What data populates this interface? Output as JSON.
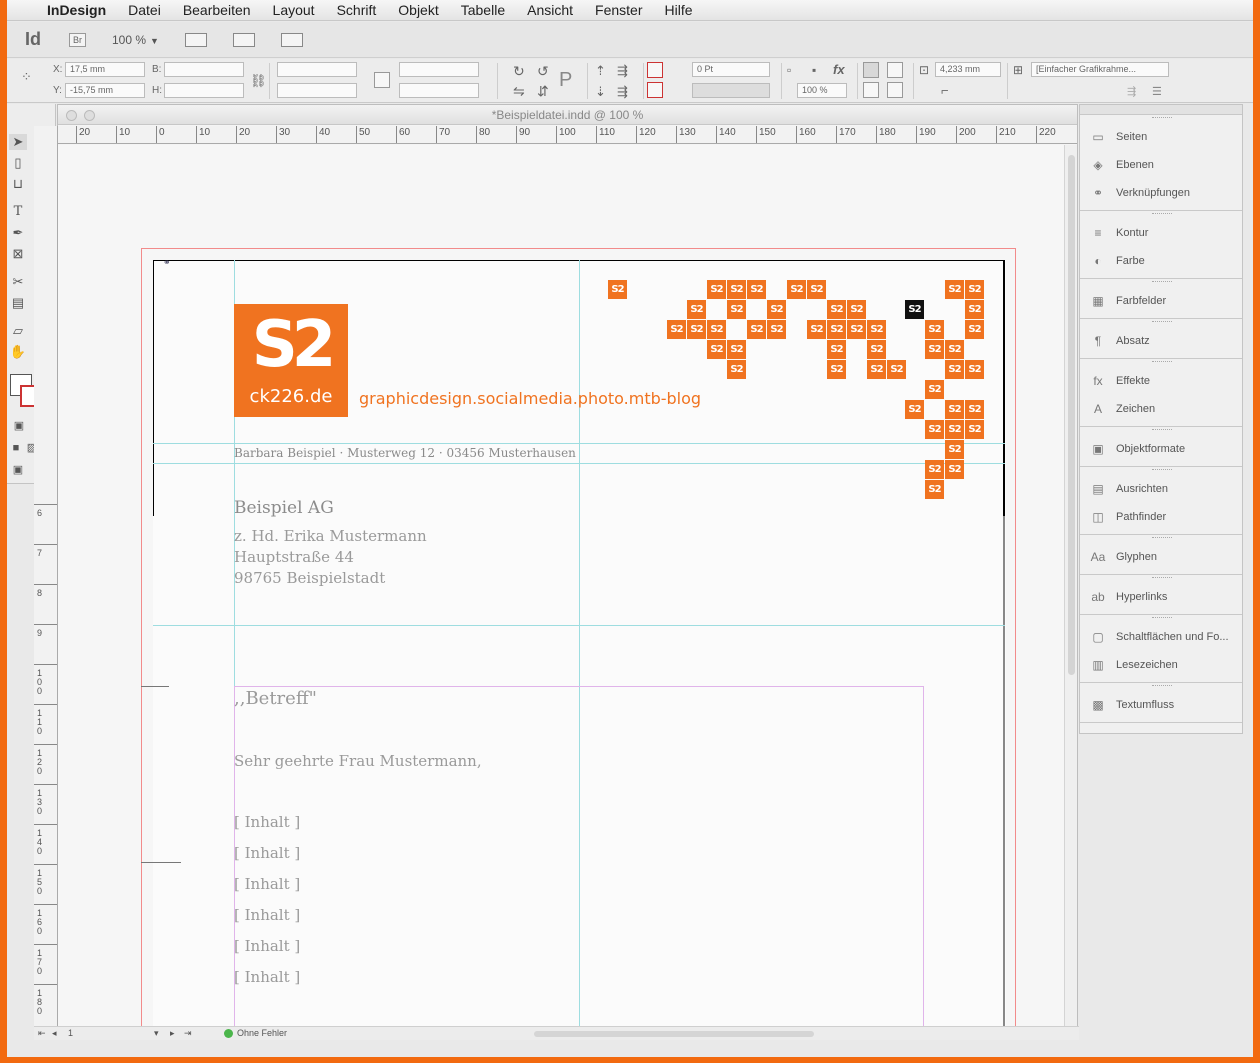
{
  "menubar": {
    "app_name": "InDesign",
    "items": [
      "Datei",
      "Bearbeiten",
      "Layout",
      "Schrift",
      "Objekt",
      "Tabelle",
      "Ansicht",
      "Fenster",
      "Hilfe"
    ]
  },
  "appbar": {
    "logo": "Id",
    "bridge": "Br",
    "zoom": "100 %"
  },
  "control": {
    "x_label": "X:",
    "x_value": "17,5 mm",
    "y_label": "Y:",
    "y_value": "-15,75 mm",
    "b_label": "B:",
    "h_label": "H:",
    "stroke_weight": "0 Pt",
    "opacity": "100 %",
    "fx_label": "fx",
    "width_value": "4,233 mm",
    "frame_style": "[Einfacher Grafikrahme..."
  },
  "document": {
    "title": "*Beispieldatei.indd @ 100 %",
    "ruler_h": [
      "20",
      "10",
      "0",
      "10",
      "20",
      "30",
      "40",
      "50",
      "60",
      "70",
      "80",
      "90",
      "100",
      "110",
      "120",
      "130",
      "140",
      "150",
      "160",
      "170",
      "180",
      "190",
      "200",
      "210",
      "220"
    ],
    "ruler_v": [
      "6",
      "7",
      "8",
      "9",
      "100",
      "110",
      "120",
      "130",
      "140",
      "150",
      "160",
      "170",
      "180"
    ],
    "status": {
      "page": "1",
      "errors": "Ohne Fehler"
    }
  },
  "letter": {
    "logo_symbol": "S2",
    "logo_domain": "ck226.de",
    "tagline": "graphicdesign.socialmedia.photo.mtb-blog",
    "sender_line": "Barbara Beispiel · Musterweg 12 · 03456 Musterhausen",
    "recipient": {
      "company": "Beispiel AG",
      "lines": [
        "z. Hd. Erika Mustermann",
        "Hauptstraße 44",
        "98765 Beispielstadt"
      ]
    },
    "subject": ",,Betreff\"",
    "salutation": "Sehr geehrte Frau Mustermann,",
    "content": [
      "[ Inhalt ]",
      "[ Inhalt ]",
      "[ Inhalt ]",
      "[ Inhalt ]",
      "[ Inhalt ]",
      "[ Inhalt ]"
    ],
    "tile_glyph": "S2",
    "brand_color": "#f07320"
  },
  "panels": {
    "groups": [
      [
        {
          "icon": "pages-icon",
          "label": "Seiten"
        },
        {
          "icon": "layers-icon",
          "label": "Ebenen"
        },
        {
          "icon": "links-icon",
          "label": "Verknüpfungen"
        }
      ],
      [
        {
          "icon": "stroke-icon",
          "label": "Kontur"
        },
        {
          "icon": "color-icon",
          "label": "Farbe"
        }
      ],
      [
        {
          "icon": "swatches-icon",
          "label": "Farbfelder"
        }
      ],
      [
        {
          "icon": "paragraph-icon",
          "label": "Absatz"
        }
      ],
      [
        {
          "icon": "effects-icon",
          "label": "Effekte"
        },
        {
          "icon": "character-icon",
          "label": "Zeichen"
        }
      ],
      [
        {
          "icon": "object-styles-icon",
          "label": "Objektformate"
        }
      ],
      [
        {
          "icon": "align-icon",
          "label": "Ausrichten"
        },
        {
          "icon": "pathfinder-icon",
          "label": "Pathfinder"
        }
      ],
      [
        {
          "icon": "glyphs-icon",
          "label": "Glyphen"
        }
      ],
      [
        {
          "icon": "hyperlinks-icon",
          "label": "Hyperlinks"
        }
      ],
      [
        {
          "icon": "buttons-icon",
          "label": "Schaltflächen und Fo..."
        },
        {
          "icon": "bookmarks-icon",
          "label": "Lesezeichen"
        }
      ],
      [
        {
          "icon": "text-wrap-icon",
          "label": "Textumfluss"
        }
      ]
    ]
  }
}
